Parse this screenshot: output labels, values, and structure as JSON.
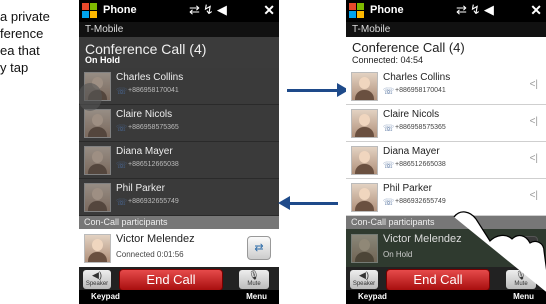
{
  "caption": [
    "a private",
    "ference",
    "ea that",
    "y tap"
  ],
  "left": {
    "app_title": "Phone",
    "carrier": "T-Mobile",
    "conf_title": "Conference Call (4)",
    "conf_sub": "On Hold",
    "participants": [
      {
        "name": "Charles Collins",
        "number": "+886958170041"
      },
      {
        "name": "Claire Nicols",
        "number": "+886958575365"
      },
      {
        "name": "Diana Mayer",
        "number": "+886512665038"
      },
      {
        "name": "Phil Parker",
        "number": "+886932655749"
      }
    ],
    "section_label": "Con-Call participants",
    "active": {
      "name": "Victor Melendez",
      "sub": "Connected 0:01:56"
    },
    "speaker_label": "Speaker",
    "end_call": "End Call",
    "mute_label": "Mute",
    "softkey_left": "Keypad",
    "softkey_right": "Menu"
  },
  "right": {
    "app_title": "Phone",
    "carrier": "T-Mobile",
    "conf_title": "Conference Call (4)",
    "conf_sub": "Connected: 04:54",
    "participants": [
      {
        "name": "Charles Collins",
        "number": "+886958170041"
      },
      {
        "name": "Claire Nicols",
        "number": "+886958575365"
      },
      {
        "name": "Diana Mayer",
        "number": "+886512665038"
      },
      {
        "name": "Phil Parker",
        "number": "+886932655749"
      }
    ],
    "section_label": "Con-Call participants",
    "active": {
      "name": "Victor Melendez",
      "sub": "On Hold"
    },
    "speaker_label": "Speaker",
    "end_call": "End Call",
    "mute_label": "Mute",
    "softkey_left": "Keypad",
    "softkey_right": "Menu"
  },
  "colors": {
    "arrow": "#1e4a8a",
    "end_call": "#c62020"
  }
}
